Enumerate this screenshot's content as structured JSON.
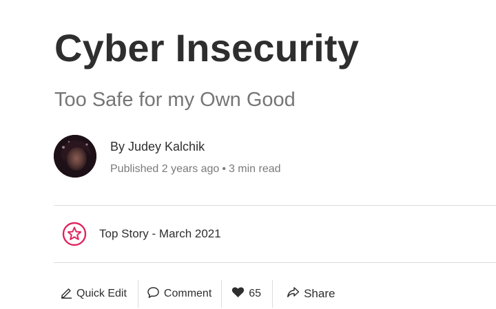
{
  "article": {
    "title": "Cyber Insecurity",
    "subtitle": "Too Safe for my Own Good",
    "author": "By Judey Kalchik",
    "published": "Published 2 years ago",
    "separator": "•",
    "read_time": "3 min read"
  },
  "badge": {
    "icon": "star-badge-icon",
    "text": "Top Story - March 2021",
    "color": "#e0245e"
  },
  "actions": {
    "quick_edit": "Quick Edit",
    "comment": "Comment",
    "likes": "65",
    "share": "Share"
  }
}
